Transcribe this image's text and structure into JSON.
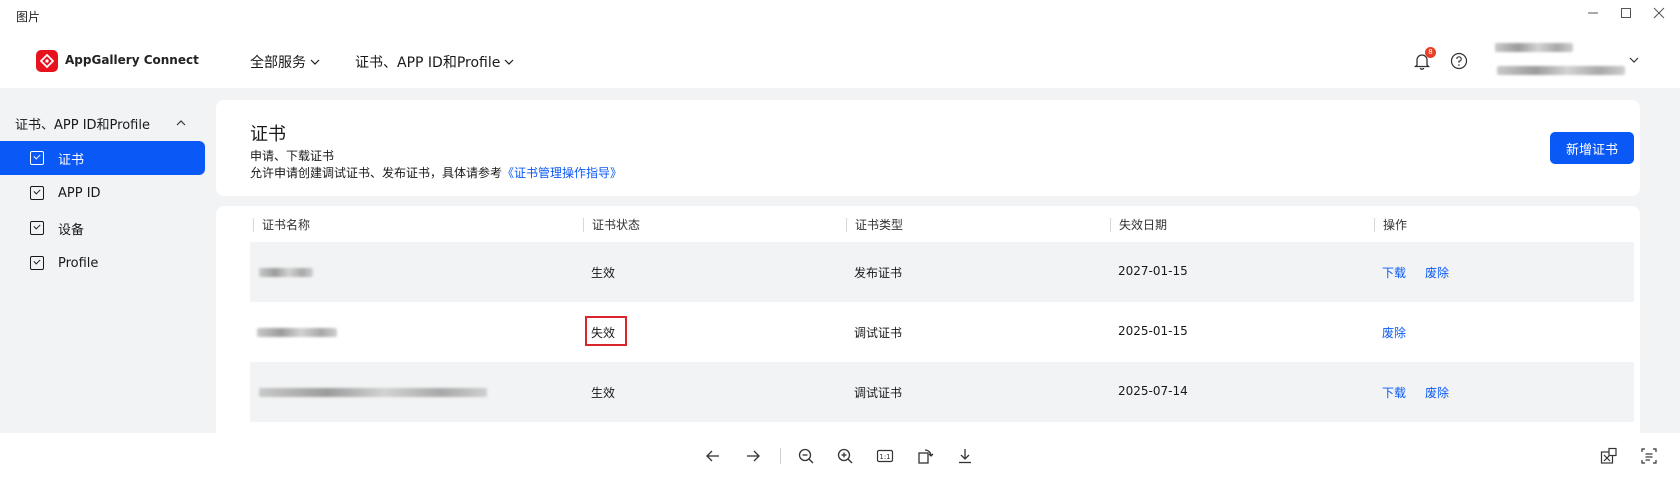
{
  "window": {
    "title": "图片"
  },
  "brand": {
    "name": "AppGallery Connect"
  },
  "topnav": {
    "all_services": "全部服务",
    "cert_menu": "证书、APP ID和Profile"
  },
  "header": {
    "notification_count": "8"
  },
  "sidebar": {
    "group_label": "证书、APP ID和Profile",
    "items": [
      {
        "label": "证书",
        "active": true
      },
      {
        "label": "APP ID",
        "active": false
      },
      {
        "label": "设备",
        "active": false
      },
      {
        "label": "Profile",
        "active": false
      }
    ]
  },
  "page": {
    "title": "证书",
    "desc_line1": "申请、下载证书",
    "desc_line2_prefix": "允许申请创建调试证书、发布证书，具体请参考",
    "desc_link": "《证书管理操作指导》",
    "add_button": "新增证书"
  },
  "table": {
    "columns": [
      "证书名称",
      "证书状态",
      "证书类型",
      "失效日期",
      "操作"
    ],
    "rows": [
      {
        "status": "生效",
        "type": "发布证书",
        "expiry": "2027-01-15",
        "actions": [
          "下载",
          "废除"
        ]
      },
      {
        "status": "失效",
        "type": "调试证书",
        "expiry": "2025-01-15",
        "actions": [
          "废除"
        ]
      },
      {
        "status": "生效",
        "type": "调试证书",
        "expiry": "2025-07-14",
        "actions": [
          "下载",
          "废除"
        ]
      }
    ]
  },
  "viewer_toolbar": {
    "actual_size_label": "1:1"
  },
  "colors": {
    "primary": "#0a59f7",
    "brand_red": "#e8121e",
    "highlight_red": "#d9262c",
    "page_bg": "#f1f3f5"
  }
}
